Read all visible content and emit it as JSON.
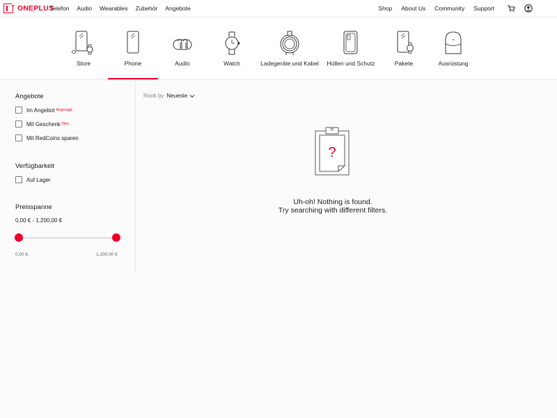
{
  "brand": {
    "logo_text": "ONEPLUS",
    "accent": "#eb0028"
  },
  "topnav": {
    "left": [
      "Telefon",
      "Audio",
      "Wearables",
      "Zubehör",
      "Angebote"
    ],
    "right": [
      "Shop",
      "About Us",
      "Community",
      "Support"
    ],
    "icons": [
      "cart-icon",
      "user-icon"
    ]
  },
  "categories": [
    {
      "label": "Store",
      "icon": "store-icon"
    },
    {
      "label": "Phone",
      "icon": "phone-icon",
      "active": true
    },
    {
      "label": "Audio",
      "icon": "earbuds-icon"
    },
    {
      "label": "Watch",
      "icon": "watch-icon"
    },
    {
      "label": "Ladegeräte und Kabel",
      "icon": "cable-icon"
    },
    {
      "label": "Hüllen und Schutz",
      "icon": "case-icon"
    },
    {
      "label": "Pakete",
      "icon": "bundle-icon"
    },
    {
      "label": "Ausrüstung",
      "icon": "backpack-icon"
    }
  ],
  "filters": {
    "offers": {
      "title": "Angebote",
      "items": [
        {
          "label": "Im Angebot",
          "tag": "Angesagt",
          "checked": false
        },
        {
          "label": "Mit Geschenk",
          "tag": "Neu",
          "checked": false
        },
        {
          "label": "Mit RedCoins sparen",
          "tag": "",
          "checked": false
        }
      ]
    },
    "availability": {
      "title": "Verfügbarkeit",
      "items": [
        {
          "label": "Auf Lager",
          "checked": false
        }
      ]
    },
    "price": {
      "title": "Preisspanne",
      "range_text": "0,00 € - 1.200,00 €",
      "min_label": "0,00 €",
      "max_label": "1.200,00 €",
      "min_fraction": 0,
      "max_fraction": 1
    }
  },
  "sort": {
    "label": "Rank by",
    "value": "Neueste"
  },
  "empty": {
    "title": "Uh-oh! Nothing is found.",
    "subtitle": "Try searching with different filters."
  }
}
